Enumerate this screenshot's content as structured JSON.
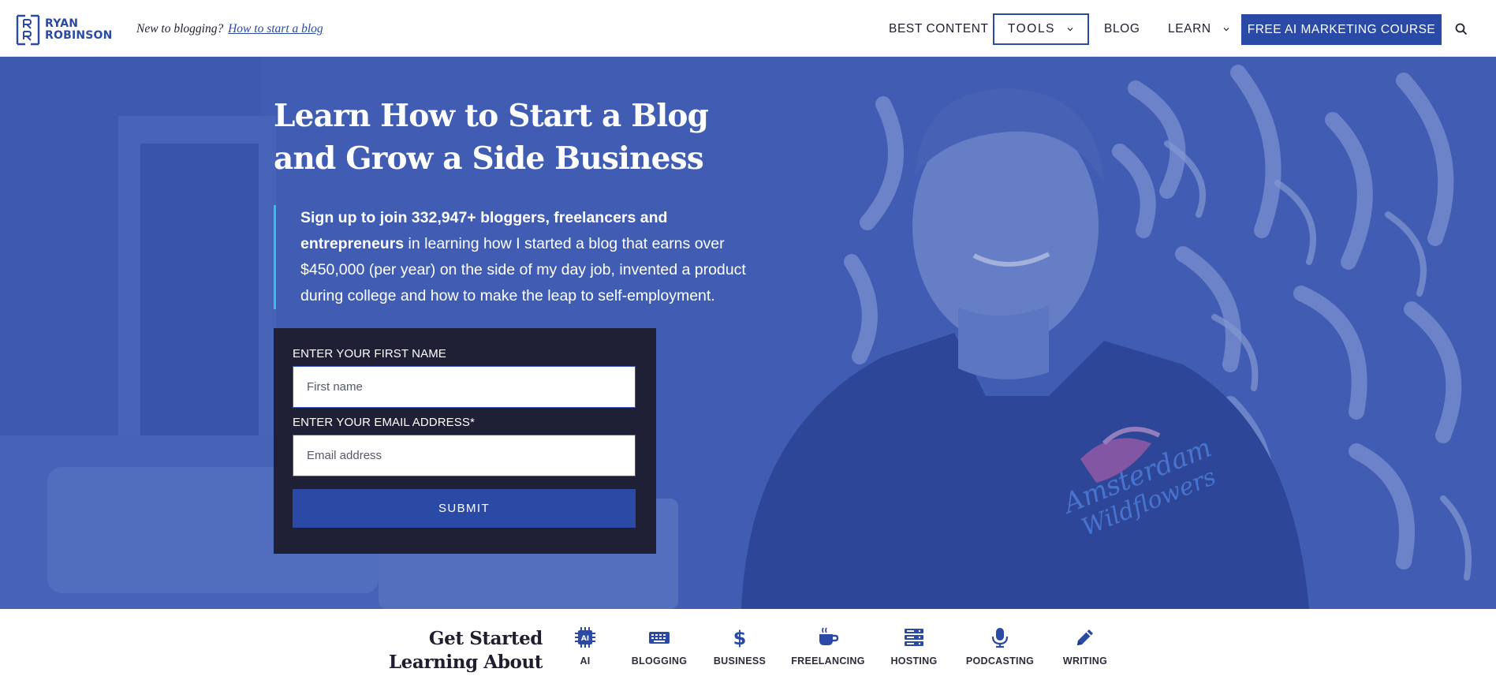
{
  "brand": {
    "name_line1": "RYAN",
    "name_line2": "ROBINSON",
    "accent": "#2a4aa6",
    "dark": "#1f1f36",
    "quote_bar": "#35c2e0"
  },
  "header": {
    "tagline_prefix": "New to blogging?",
    "tagline_link": "How to start a blog",
    "nav": {
      "best_content": "BEST CONTENT",
      "tools": "TOOLS",
      "blog": "BLOG",
      "learn": "LEARN"
    },
    "cta": "FREE AI MARKETING COURSE",
    "search_icon": "search-icon"
  },
  "hero": {
    "title_line1": "Learn How to Start a Blog",
    "title_line2": "and Grow a Side Business",
    "quote_bold": "Sign up to join 332,947+ bloggers, freelancers and entrepreneurs",
    "quote_rest": " in learning how I started a blog that earns over $450,000 (per year) on the side of my day job, invented a product during college and how to make the leap to self-employment."
  },
  "form": {
    "first_name_label": "ENTER YOUR FIRST NAME",
    "first_name_placeholder": "First name",
    "first_name_value": "",
    "email_label": "ENTER YOUR EMAIL ADDRESS*",
    "email_placeholder": "Email address",
    "email_value": "",
    "submit": "SUBMIT"
  },
  "topics": {
    "title_line1": "Get Started",
    "title_line2": "Learning About",
    "items": [
      {
        "label": "AI",
        "icon": "ai-chip-icon"
      },
      {
        "label": "BLOGGING",
        "icon": "keyboard-icon"
      },
      {
        "label": "BUSINESS",
        "icon": "dollar-icon"
      },
      {
        "label": "FREELANCING",
        "icon": "coffee-cup-icon"
      },
      {
        "label": "HOSTING",
        "icon": "server-icon"
      },
      {
        "label": "PODCASTING",
        "icon": "microphone-icon"
      },
      {
        "label": "WRITING",
        "icon": "pencil-icon"
      }
    ]
  }
}
